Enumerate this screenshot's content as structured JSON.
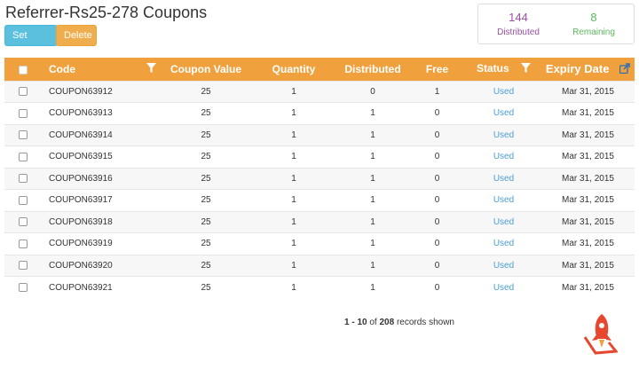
{
  "page": {
    "title": "Referrer-Rs25-278 Coupons"
  },
  "toolbar": {
    "set_used_label": "Set Used",
    "delete_label": "Delete"
  },
  "stats": {
    "distributed": {
      "value": "144",
      "label": "Distributed"
    },
    "remaining": {
      "value": "8",
      "label": "Remaining"
    }
  },
  "table": {
    "headers": {
      "code": "Code",
      "coupon_value": "Coupon Value",
      "quantity": "Quantity",
      "distributed": "Distributed",
      "free": "Free",
      "status": "Status",
      "expiry": "Expiry Date"
    },
    "rows": [
      {
        "code": "COUPON63912",
        "value": "25",
        "quantity": "1",
        "distributed": "0",
        "free": "1",
        "status": "Used",
        "expiry": "Mar 31, 2015"
      },
      {
        "code": "COUPON63913",
        "value": "25",
        "quantity": "1",
        "distributed": "1",
        "free": "0",
        "status": "Used",
        "expiry": "Mar 31, 2015"
      },
      {
        "code": "COUPON63914",
        "value": "25",
        "quantity": "1",
        "distributed": "1",
        "free": "0",
        "status": "Used",
        "expiry": "Mar 31, 2015"
      },
      {
        "code": "COUPON63915",
        "value": "25",
        "quantity": "1",
        "distributed": "1",
        "free": "0",
        "status": "Used",
        "expiry": "Mar 31, 2015"
      },
      {
        "code": "COUPON63916",
        "value": "25",
        "quantity": "1",
        "distributed": "1",
        "free": "0",
        "status": "Used",
        "expiry": "Mar 31, 2015"
      },
      {
        "code": "COUPON63917",
        "value": "25",
        "quantity": "1",
        "distributed": "1",
        "free": "0",
        "status": "Used",
        "expiry": "Mar 31, 2015"
      },
      {
        "code": "COUPON63918",
        "value": "25",
        "quantity": "1",
        "distributed": "1",
        "free": "0",
        "status": "Used",
        "expiry": "Mar 31, 2015"
      },
      {
        "code": "COUPON63919",
        "value": "25",
        "quantity": "1",
        "distributed": "1",
        "free": "0",
        "status": "Used",
        "expiry": "Mar 31, 2015"
      },
      {
        "code": "COUPON63920",
        "value": "25",
        "quantity": "1",
        "distributed": "1",
        "free": "0",
        "status": "Used",
        "expiry": "Mar 31, 2015"
      },
      {
        "code": "COUPON63921",
        "value": "25",
        "quantity": "1",
        "distributed": "1",
        "free": "0",
        "status": "Used",
        "expiry": "Mar 31, 2015"
      }
    ]
  },
  "footer": {
    "range": "1 - 10",
    "of_text": "of",
    "total": "208",
    "suffix": "records shown"
  },
  "icons": {
    "filter": "filter-icon",
    "export": "export-icon",
    "logo": "rocket-logo"
  },
  "colors": {
    "header_bg": "#f0a13d",
    "set_used": "#5bc0de",
    "delete": "#f0ad4e",
    "distributed": "#9b4fa6",
    "remaining": "#5cb85c",
    "status_link": "#4a9fd5"
  }
}
